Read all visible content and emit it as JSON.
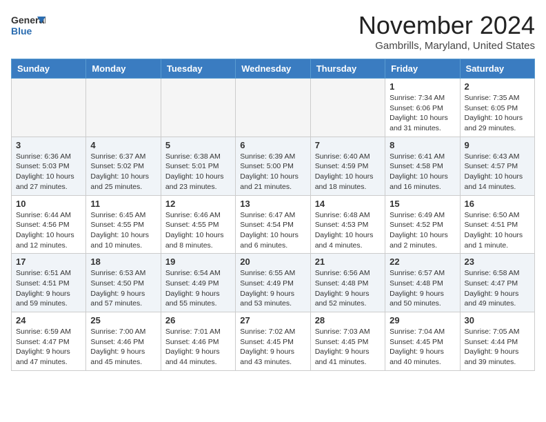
{
  "header": {
    "logo_general": "General",
    "logo_blue": "Blue",
    "month_title": "November 2024",
    "location": "Gambrills, Maryland, United States"
  },
  "days_of_week": [
    "Sunday",
    "Monday",
    "Tuesday",
    "Wednesday",
    "Thursday",
    "Friday",
    "Saturday"
  ],
  "weeks": [
    {
      "days": [
        {
          "num": "",
          "info": "",
          "empty": true
        },
        {
          "num": "",
          "info": "",
          "empty": true
        },
        {
          "num": "",
          "info": "",
          "empty": true
        },
        {
          "num": "",
          "info": "",
          "empty": true
        },
        {
          "num": "",
          "info": "",
          "empty": true
        },
        {
          "num": "1",
          "info": "Sunrise: 7:34 AM\nSunset: 6:06 PM\nDaylight: 10 hours\nand 31 minutes.",
          "empty": false
        },
        {
          "num": "2",
          "info": "Sunrise: 7:35 AM\nSunset: 6:05 PM\nDaylight: 10 hours\nand 29 minutes.",
          "empty": false
        }
      ]
    },
    {
      "days": [
        {
          "num": "3",
          "info": "Sunrise: 6:36 AM\nSunset: 5:03 PM\nDaylight: 10 hours\nand 27 minutes.",
          "empty": false
        },
        {
          "num": "4",
          "info": "Sunrise: 6:37 AM\nSunset: 5:02 PM\nDaylight: 10 hours\nand 25 minutes.",
          "empty": false
        },
        {
          "num": "5",
          "info": "Sunrise: 6:38 AM\nSunset: 5:01 PM\nDaylight: 10 hours\nand 23 minutes.",
          "empty": false
        },
        {
          "num": "6",
          "info": "Sunrise: 6:39 AM\nSunset: 5:00 PM\nDaylight: 10 hours\nand 21 minutes.",
          "empty": false
        },
        {
          "num": "7",
          "info": "Sunrise: 6:40 AM\nSunset: 4:59 PM\nDaylight: 10 hours\nand 18 minutes.",
          "empty": false
        },
        {
          "num": "8",
          "info": "Sunrise: 6:41 AM\nSunset: 4:58 PM\nDaylight: 10 hours\nand 16 minutes.",
          "empty": false
        },
        {
          "num": "9",
          "info": "Sunrise: 6:43 AM\nSunset: 4:57 PM\nDaylight: 10 hours\nand 14 minutes.",
          "empty": false
        }
      ]
    },
    {
      "days": [
        {
          "num": "10",
          "info": "Sunrise: 6:44 AM\nSunset: 4:56 PM\nDaylight: 10 hours\nand 12 minutes.",
          "empty": false
        },
        {
          "num": "11",
          "info": "Sunrise: 6:45 AM\nSunset: 4:55 PM\nDaylight: 10 hours\nand 10 minutes.",
          "empty": false
        },
        {
          "num": "12",
          "info": "Sunrise: 6:46 AM\nSunset: 4:55 PM\nDaylight: 10 hours\nand 8 minutes.",
          "empty": false
        },
        {
          "num": "13",
          "info": "Sunrise: 6:47 AM\nSunset: 4:54 PM\nDaylight: 10 hours\nand 6 minutes.",
          "empty": false
        },
        {
          "num": "14",
          "info": "Sunrise: 6:48 AM\nSunset: 4:53 PM\nDaylight: 10 hours\nand 4 minutes.",
          "empty": false
        },
        {
          "num": "15",
          "info": "Sunrise: 6:49 AM\nSunset: 4:52 PM\nDaylight: 10 hours\nand 2 minutes.",
          "empty": false
        },
        {
          "num": "16",
          "info": "Sunrise: 6:50 AM\nSunset: 4:51 PM\nDaylight: 10 hours\nand 1 minute.",
          "empty": false
        }
      ]
    },
    {
      "days": [
        {
          "num": "17",
          "info": "Sunrise: 6:51 AM\nSunset: 4:51 PM\nDaylight: 9 hours\nand 59 minutes.",
          "empty": false
        },
        {
          "num": "18",
          "info": "Sunrise: 6:53 AM\nSunset: 4:50 PM\nDaylight: 9 hours\nand 57 minutes.",
          "empty": false
        },
        {
          "num": "19",
          "info": "Sunrise: 6:54 AM\nSunset: 4:49 PM\nDaylight: 9 hours\nand 55 minutes.",
          "empty": false
        },
        {
          "num": "20",
          "info": "Sunrise: 6:55 AM\nSunset: 4:49 PM\nDaylight: 9 hours\nand 53 minutes.",
          "empty": false
        },
        {
          "num": "21",
          "info": "Sunrise: 6:56 AM\nSunset: 4:48 PM\nDaylight: 9 hours\nand 52 minutes.",
          "empty": false
        },
        {
          "num": "22",
          "info": "Sunrise: 6:57 AM\nSunset: 4:48 PM\nDaylight: 9 hours\nand 50 minutes.",
          "empty": false
        },
        {
          "num": "23",
          "info": "Sunrise: 6:58 AM\nSunset: 4:47 PM\nDaylight: 9 hours\nand 49 minutes.",
          "empty": false
        }
      ]
    },
    {
      "days": [
        {
          "num": "24",
          "info": "Sunrise: 6:59 AM\nSunset: 4:47 PM\nDaylight: 9 hours\nand 47 minutes.",
          "empty": false
        },
        {
          "num": "25",
          "info": "Sunrise: 7:00 AM\nSunset: 4:46 PM\nDaylight: 9 hours\nand 45 minutes.",
          "empty": false
        },
        {
          "num": "26",
          "info": "Sunrise: 7:01 AM\nSunset: 4:46 PM\nDaylight: 9 hours\nand 44 minutes.",
          "empty": false
        },
        {
          "num": "27",
          "info": "Sunrise: 7:02 AM\nSunset: 4:45 PM\nDaylight: 9 hours\nand 43 minutes.",
          "empty": false
        },
        {
          "num": "28",
          "info": "Sunrise: 7:03 AM\nSunset: 4:45 PM\nDaylight: 9 hours\nand 41 minutes.",
          "empty": false
        },
        {
          "num": "29",
          "info": "Sunrise: 7:04 AM\nSunset: 4:45 PM\nDaylight: 9 hours\nand 40 minutes.",
          "empty": false
        },
        {
          "num": "30",
          "info": "Sunrise: 7:05 AM\nSunset: 4:44 PM\nDaylight: 9 hours\nand 39 minutes.",
          "empty": false
        }
      ]
    }
  ]
}
